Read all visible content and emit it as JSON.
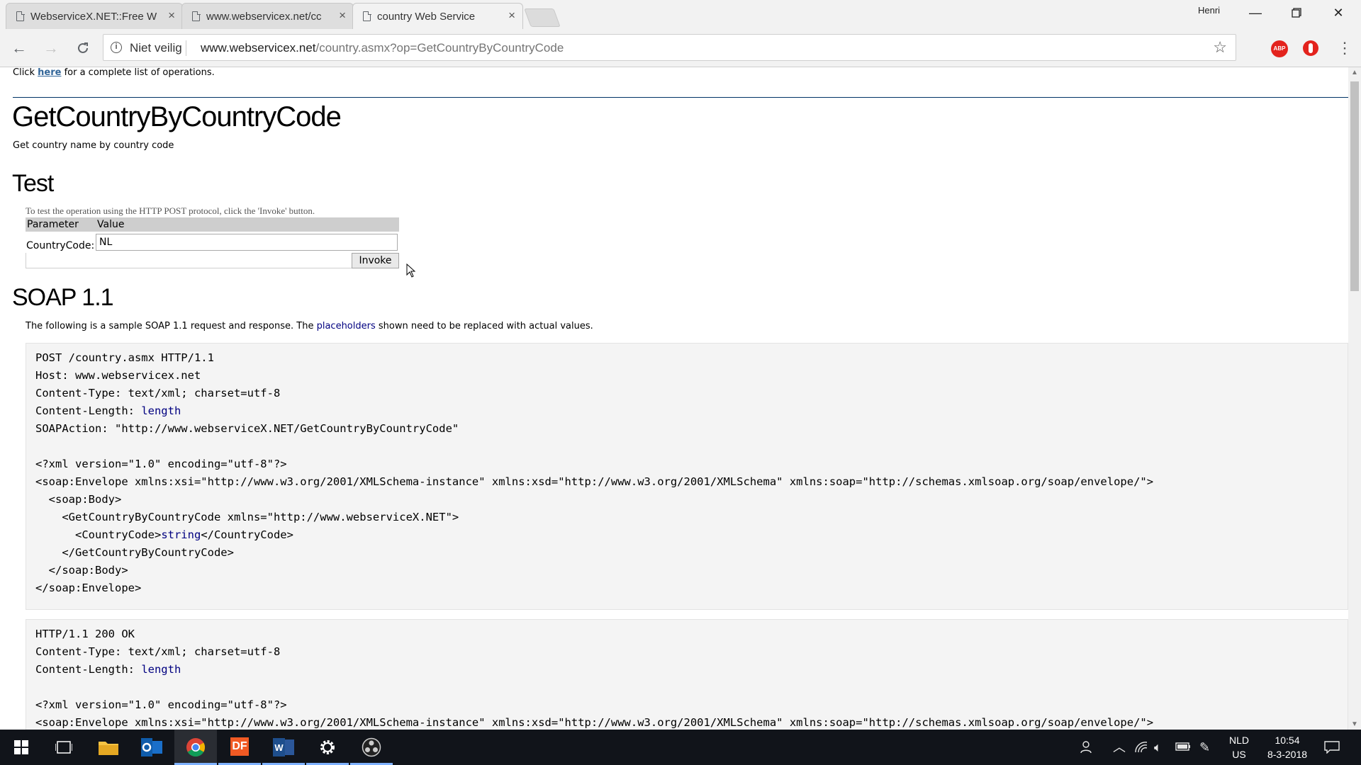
{
  "browser": {
    "tabs": [
      {
        "title": "WebserviceX.NET::Free W",
        "active": false
      },
      {
        "title": "www.webservicex.net/cc",
        "active": false
      },
      {
        "title": "country Web Service",
        "active": true
      }
    ],
    "profile_name": "Henri",
    "security_label": "Niet veilig",
    "url_host": "www.webservicex.net",
    "url_path": "/country.asmx?op=GetCountryByCountryCode",
    "extensions": [
      "ABP",
      "ublock-icon"
    ]
  },
  "page": {
    "ops_line": {
      "prefix": "Click",
      "link": "here",
      "suffix": "for a complete list of operations."
    },
    "operation_title": "GetCountryByCountryCode",
    "operation_desc": "Get country name by country code",
    "test": {
      "heading": "Test",
      "note": "To test the operation using the HTTP POST protocol, click the 'Invoke' button.",
      "col_parameter": "Parameter",
      "col_value": "Value",
      "param_label": "CountryCode:",
      "param_value": "NL",
      "invoke_label": "Invoke"
    },
    "soap": {
      "heading": "SOAP 1.1",
      "note_prefix": "The following is a sample SOAP 1.1 request and response. The",
      "note_link": "placeholders",
      "note_suffix": "shown need to be replaced with actual values.",
      "request": {
        "l1": "POST /country.asmx HTTP/1.1",
        "l2": "Host: www.webservicex.net",
        "l3": "Content-Type: text/xml; charset=utf-8",
        "l4a": "Content-Length: ",
        "l4b": "length",
        "l5": "SOAPAction: \"http://www.webserviceX.NET/GetCountryByCountryCode\"",
        "l7": "<?xml version=\"1.0\" encoding=\"utf-8\"?>",
        "l8": "<soap:Envelope xmlns:xsi=\"http://www.w3.org/2001/XMLSchema-instance\" xmlns:xsd=\"http://www.w3.org/2001/XMLSchema\" xmlns:soap=\"http://schemas.xmlsoap.org/soap/envelope/\">",
        "l9": "  <soap:Body>",
        "l10": "    <GetCountryByCountryCode xmlns=\"http://www.webserviceX.NET\">",
        "l11a": "      <CountryCode>",
        "l11b": "string",
        "l11c": "</CountryCode>",
        "l12": "    </GetCountryByCountryCode>",
        "l13": "  </soap:Body>",
        "l14": "</soap:Envelope>"
      },
      "response": {
        "l1": "HTTP/1.1 200 OK",
        "l2": "Content-Type: text/xml; charset=utf-8",
        "l3a": "Content-Length: ",
        "l3b": "length",
        "l5": "<?xml version=\"1.0\" encoding=\"utf-8\"?>",
        "l6": "<soap:Envelope xmlns:xsi=\"http://www.w3.org/2001/XMLSchema-instance\" xmlns:xsd=\"http://www.w3.org/2001/XMLSchema\" xmlns:soap=\"http://schemas.xmlsoap.org/soap/envelope/\">"
      }
    }
  },
  "taskbar": {
    "apps": [
      "windows-start-icon",
      "task-view-icon",
      "file-explorer-icon",
      "outlook-icon",
      "chrome-icon",
      "foxit-icon",
      "word-icon",
      "settings-icon",
      "obs-icon"
    ],
    "language_line1": "NLD",
    "language_line2": "US",
    "time": "10:54",
    "date": "8-3-2018"
  },
  "colors": {
    "link": "#336699",
    "placeholder": "#000080",
    "rule": "#003366",
    "code_bg": "#f4f4f4",
    "taskbar": "#11141a"
  }
}
